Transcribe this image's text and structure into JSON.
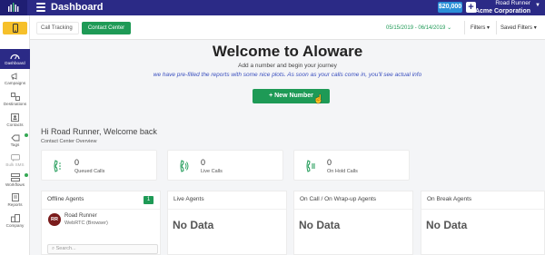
{
  "topbar": {
    "title": "Dashboard",
    "balance": "$20,000",
    "plus": "+",
    "user_name": "Road Runner",
    "company": "Acme Corporation"
  },
  "sidebar": {
    "items": [
      {
        "label": "Dashboard",
        "icon": "gauge-icon",
        "active": true
      },
      {
        "label": "Campaigns",
        "icon": "megaphone-icon"
      },
      {
        "label": "Destinations",
        "icon": "destinations-icon"
      },
      {
        "label": "Contacts",
        "icon": "contacts-icon"
      },
      {
        "label": "Tags",
        "icon": "tag-icon"
      },
      {
        "label": "Bulk SMS",
        "icon": "bulk-sms-icon"
      },
      {
        "label": "Workflows",
        "icon": "workflow-icon"
      },
      {
        "label": "Reports",
        "icon": "report-icon"
      },
      {
        "label": "Company",
        "icon": "company-icon"
      }
    ]
  },
  "subbar": {
    "tab_call": "Call Tracking",
    "tab_contact": "Contact Center",
    "date_range": "05/15/2019 - 06/14/2019",
    "filters": "Filters",
    "saved_filters": "Saved Filters"
  },
  "welcome": {
    "title": "Welcome to Aloware",
    "line1": "Add a number and begin your journey",
    "line2": "we have pre-filled the reports with some nice plots. As soon as your calls come in, you'll see actual info",
    "button": "New Number"
  },
  "greeting": "Hi Road Runner, Welcome back",
  "overview_label": "Contact Center Overview",
  "stats": [
    {
      "value": "0",
      "label": "Queued Calls"
    },
    {
      "value": "0",
      "label": "Live Calls"
    },
    {
      "value": "0",
      "label": "On Hold Calls"
    }
  ],
  "panels": {
    "offline": {
      "title": "Offline Agents",
      "count": "1",
      "agent_initials": "RR",
      "agent_name": "Road Runner",
      "agent_status": "WebRTC (Browser)",
      "search_placeholder": "Search..."
    },
    "live": {
      "title": "Live Agents",
      "empty": "No Data"
    },
    "oncall": {
      "title": "On Call / On Wrap-up Agents",
      "empty": "No Data"
    },
    "onbreak": {
      "title": "On Break Agents",
      "empty": "No Data"
    }
  },
  "colors": {
    "brand": "#2b2a86",
    "accent": "#1e9a56",
    "phone": "#f6c02a"
  }
}
